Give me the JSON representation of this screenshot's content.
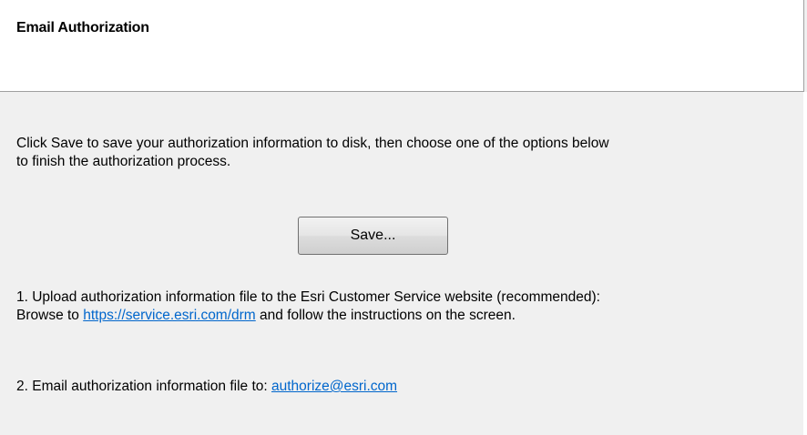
{
  "header": {
    "title": "Email Authorization"
  },
  "intro": {
    "line1": "Click Save to save your authorization information to disk, then choose one of the options below",
    "line2": "to finish the authorization process."
  },
  "save_button": {
    "label": "Save..."
  },
  "option1": {
    "line1": "1.  Upload authorization information file to the Esri Customer Service website (recommended):",
    "prefix": "Browse to ",
    "link": "https://service.esri.com/drm",
    "suffix": " and follow the instructions on the screen."
  },
  "option2": {
    "prefix": "2.  Email authorization information file to: ",
    "link": "authorize@esri.com"
  },
  "colors": {
    "panel_background": "#f0f0f0",
    "header_background": "#ffffff",
    "link": "#0066cc"
  }
}
